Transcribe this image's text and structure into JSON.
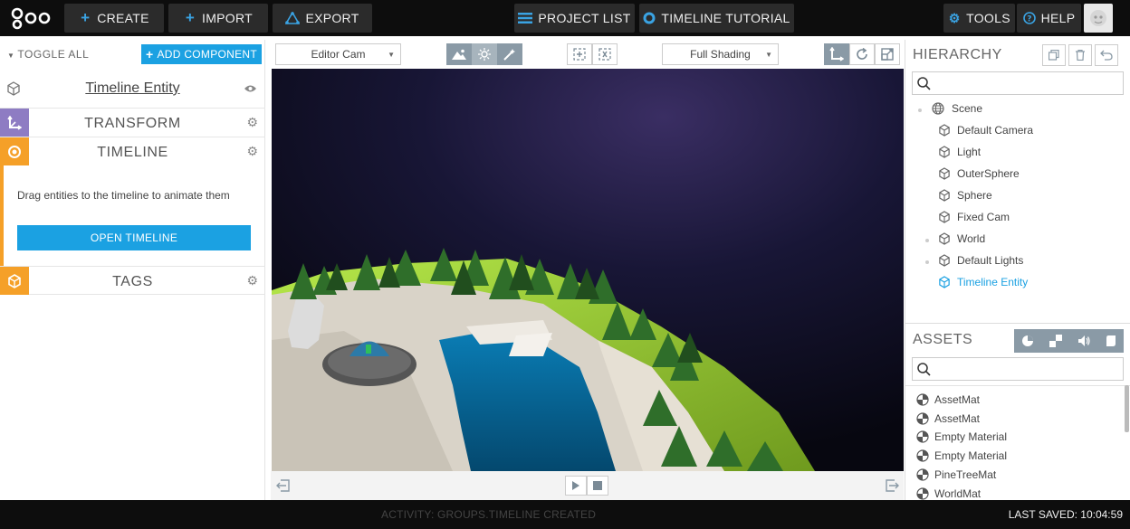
{
  "topbar": {
    "create_label": "CREATE",
    "import_label": "IMPORT",
    "export_label": "EXPORT",
    "project_list_label": "PROJECT LIST",
    "timeline_tutorial_label": "TIMELINE TUTORIAL",
    "tools_label": "TOOLS",
    "help_label": "HELP"
  },
  "left": {
    "toggle_all_label": "TOGGLE ALL",
    "add_component_label": "ADD COMPONENT",
    "entity_name": "Timeline Entity",
    "components": {
      "transform": "TRANSFORM",
      "timeline": "TIMELINE",
      "tags": "TAGS"
    },
    "timeline_hint": "Drag entities to the timeline to animate them",
    "open_timeline_label": "OPEN TIMELINE"
  },
  "viewport": {
    "camera_select": "Editor Cam",
    "shading_select": "Full Shading"
  },
  "hierarchy": {
    "title": "HIERARCHY",
    "search_placeholder": "",
    "root": "Scene",
    "items": [
      {
        "label": "Default Camera"
      },
      {
        "label": "Light"
      },
      {
        "label": "OuterSphere"
      },
      {
        "label": "Sphere"
      },
      {
        "label": "Fixed Cam"
      },
      {
        "label": "World"
      },
      {
        "label": "Default Lights"
      },
      {
        "label": "Timeline Entity"
      }
    ]
  },
  "assets": {
    "title": "ASSETS",
    "search_placeholder": "",
    "items": [
      {
        "label": "AssetMat"
      },
      {
        "label": "AssetMat"
      },
      {
        "label": "Empty Material"
      },
      {
        "label": "Empty Material"
      },
      {
        "label": "PineTreeMat"
      },
      {
        "label": "WorldMat"
      }
    ]
  },
  "status": {
    "activity": "ACTIVITY: GROUPS.TIMELINE CREATED",
    "last_saved": "LAST SAVED: 10:04:59"
  },
  "colors": {
    "accent": "#1ba1e2",
    "transform_tab": "#8e7cc3",
    "timeline_tab": "#f5a028",
    "tags_tab": "#f5a028",
    "topbar_bg": "#0d0d0d"
  }
}
